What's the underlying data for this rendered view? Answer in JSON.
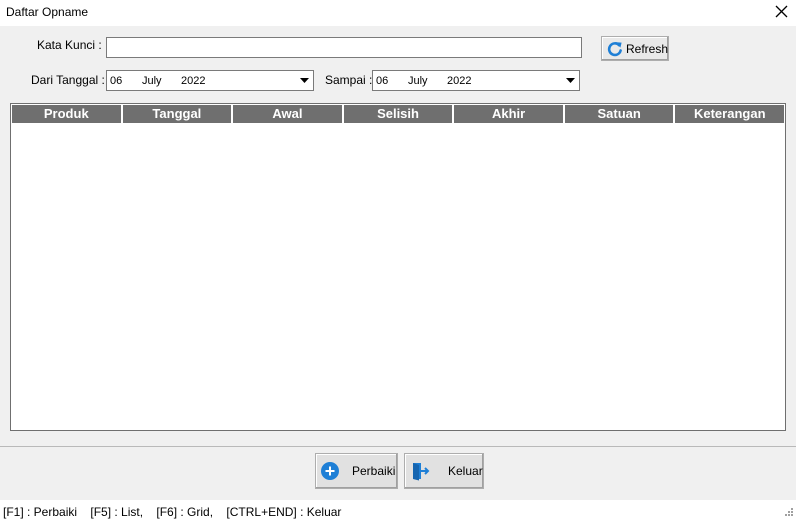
{
  "window": {
    "title": "Daftar Opname"
  },
  "filters": {
    "keyword_label": "Kata Kunci :",
    "keyword_value": "",
    "from_label": "Dari Tanggal :",
    "from_date": {
      "day": "06",
      "month": "July",
      "year": "2022"
    },
    "to_label": "Sampai :",
    "to_date": {
      "day": "06",
      "month": "July",
      "year": "2022"
    },
    "refresh_label": "Refresh"
  },
  "grid": {
    "columns": [
      "Produk",
      "Tanggal",
      "Awal",
      "Selisih",
      "Akhir",
      "Satuan",
      "Keterangan"
    ],
    "rows": []
  },
  "actions": {
    "perbaiki_label": "Perbaiki",
    "keluar_label": "Keluar"
  },
  "statusbar": {
    "shortcuts": "[F1] : Perbaiki    [F5] : List,    [F6] : Grid,    [CTRL+END] : Keluar"
  },
  "colors": {
    "header_bg": "#6f6f6f",
    "panel_bg": "#f0f0f0",
    "accent_blue": "#1e7fd6"
  },
  "icons": {
    "close": "close-icon",
    "refresh": "refresh-icon",
    "perbaiki": "plus-circle-icon",
    "keluar": "exit-door-icon",
    "dropdown": "chevron-down-icon",
    "resize": "resize-grip-icon"
  }
}
